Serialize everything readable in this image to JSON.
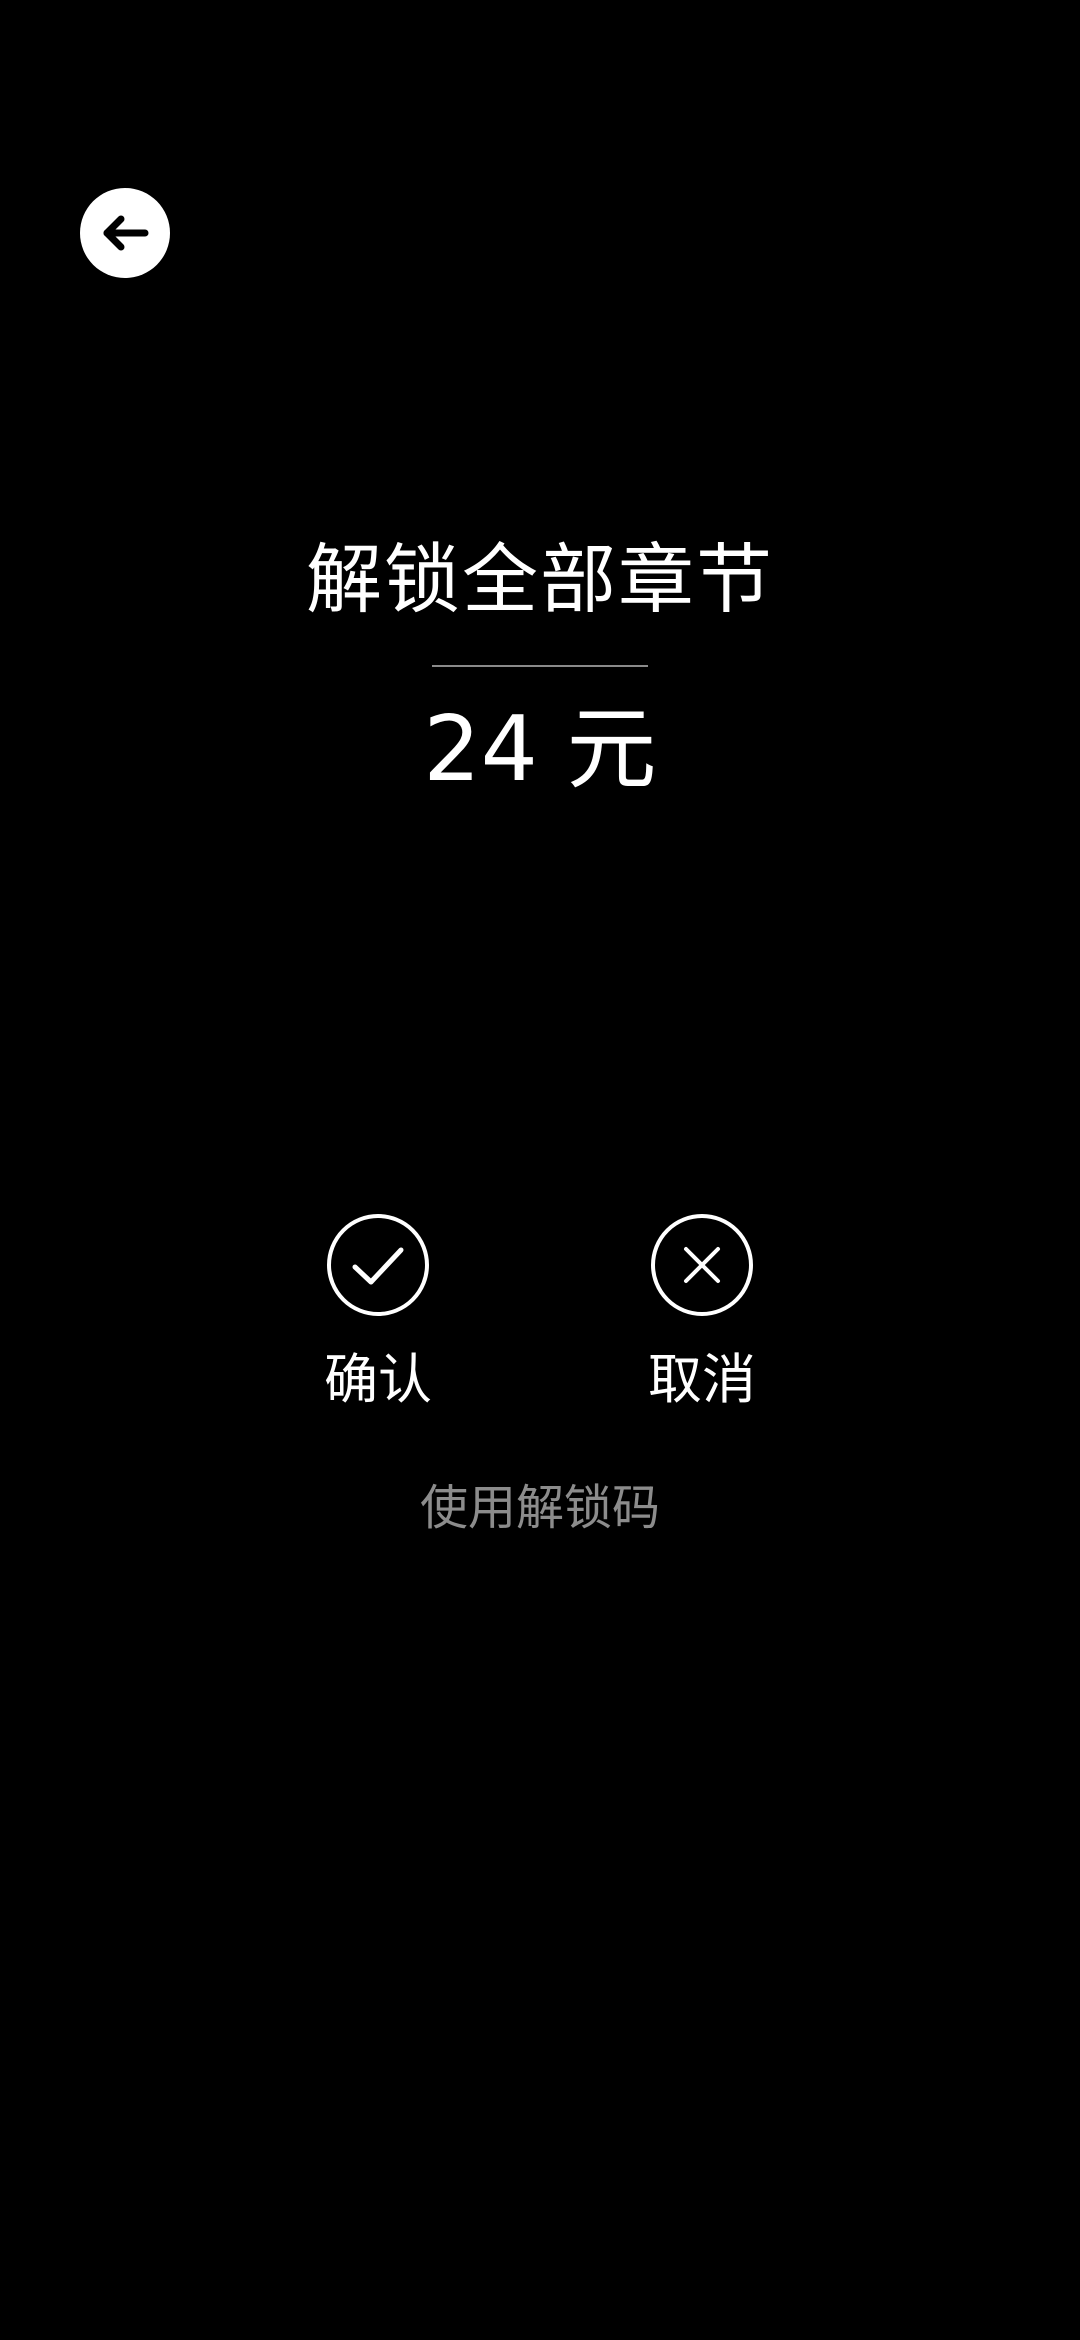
{
  "header": {
    "back_icon": "arrow-left-icon"
  },
  "main": {
    "title": "解锁全部章节",
    "price": "24 元"
  },
  "actions": {
    "confirm": {
      "label": "确认",
      "icon": "check-circle-icon"
    },
    "cancel": {
      "label": "取消",
      "icon": "x-circle-icon"
    }
  },
  "footer": {
    "unlock_code_link": "使用解锁码"
  },
  "colors": {
    "background": "#000000",
    "text": "#ffffff",
    "muted_text": "#8c8c8c",
    "divider": "#8a8a8a"
  }
}
